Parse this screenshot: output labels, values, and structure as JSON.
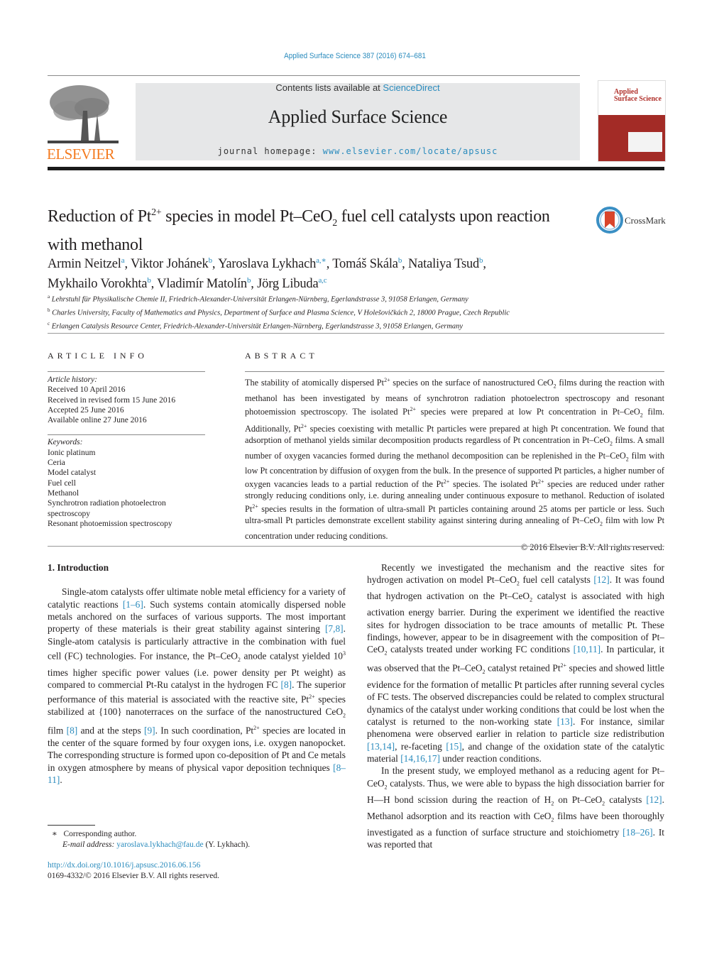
{
  "header": {
    "citation": "Applied Surface Science 387 (2016) 674–681",
    "contents_prefix": "Contents lists available at ",
    "contents_link": "ScienceDirect",
    "journal_name": "Applied Surface Science",
    "homepage_prefix": "journal homepage: ",
    "homepage_link": "www.elsevier.com/locate/apsusc",
    "publisher": "ELSEVIER",
    "cover_title_line1": "Applied",
    "cover_title_line2": "Surface Science",
    "crossmark_label": "CrossMark"
  },
  "article": {
    "title_parts": {
      "a": "Reduction of Pt",
      "a_sup": "2+",
      "b": " species in model Pt–CeO",
      "b_sub": "2",
      "c": " fuel cell catalysts upon reaction with methanol"
    },
    "authors": [
      {
        "name": "Armin Neitzel",
        "aff": "a"
      },
      {
        "name": "Viktor Johánek",
        "aff": "b"
      },
      {
        "name": "Yaroslava Lykhach",
        "aff": "a,∗"
      },
      {
        "name": "Tomáš Skála",
        "aff": "b"
      },
      {
        "name": "Nataliya Tsud",
        "aff": "b"
      },
      {
        "name": "Mykhailo Vorokhta",
        "aff": "b"
      },
      {
        "name": "Vladimír Matolín",
        "aff": "b"
      },
      {
        "name": "Jörg Libuda",
        "aff": "a,c"
      }
    ],
    "affiliations": [
      {
        "label": "a",
        "text": "Lehrstuhl für Physikalische Chemie II, Friedrich-Alexander-Universität Erlangen-Nürnberg, Egerlandstrasse 3, 91058 Erlangen, Germany"
      },
      {
        "label": "b",
        "text": "Charles University, Faculty of Mathematics and Physics, Department of Surface and Plasma Science, V Holešovičkách 2, 18000 Prague, Czech Republic"
      },
      {
        "label": "c",
        "text": "Erlangen Catalysis Resource Center, Friedrich-Alexander-Universität Erlangen-Nürnberg, Egerlandstrasse 3, 91058 Erlangen, Germany"
      }
    ]
  },
  "article_info": {
    "heading": "ARTICLE INFO",
    "history_label": "Article history:",
    "history": [
      "Received 10 April 2016",
      "Received in revised form 15 June 2016",
      "Accepted 25 June 2016",
      "Available online 27 June 2016"
    ],
    "keywords_label": "Keywords:",
    "keywords": [
      "Ionic platinum",
      "Ceria",
      "Model catalyst",
      "Fuel cell",
      "Methanol",
      "Synchrotron radiation photoelectron spectroscopy",
      "Resonant photoemission spectroscopy"
    ]
  },
  "abstract": {
    "heading": "ABSTRACT",
    "html": "The stability of atomically dispersed Pt<sup>2+</sup> species on the surface of nanostructured CeO<sub>2</sub> films during the reaction with methanol has been investigated by means of synchrotron radiation photoelectron spectroscopy and resonant photoemission spectroscopy. The isolated Pt<sup>2+</sup> species were prepared at low Pt concentration in Pt–CeO<sub>2</sub> film. Additionally, Pt<sup>2+</sup> species coexisting with metallic Pt particles were prepared at high Pt concentration. We found that adsorption of methanol yields similar decomposition products regardless of Pt concentration in Pt–CeO<sub>2</sub> films. A small number of oxygen vacancies formed during the methanol decomposition can be replenished in the Pt–CeO<sub>2</sub> film with low Pt concentration by diffusion of oxygen from the bulk. In the presence of supported Pt particles, a higher number of oxygen vacancies leads to a partial reduction of the Pt<sup>2+</sup> species. The isolated Pt<sup>2+</sup> species are reduced under rather strongly reducing conditions only, i.e. during annealing under continuous exposure to methanol. Reduction of isolated Pt<sup>2+</sup> species results in the formation of ultra-small Pt particles containing around 25 atoms per particle or less. Such ultra-small Pt particles demonstrate excellent stability against sintering during annealing of Pt–CeO<sub>2</sub> film with low Pt concentration under reducing conditions.",
    "copyright": "© 2016 Elsevier B.V. All rights reserved."
  },
  "body": {
    "section_heading": "1.  Introduction",
    "left_paragraphs_html": [
      "Single-atom catalysts offer ultimate noble metal efficiency for a variety of catalytic reactions <a>[1–6]</a>. Such systems contain atomically dispersed noble metals anchored on the surfaces of various supports. The most important property of these materials is their great stability against sintering <a>[7,8]</a>. Single-atom catalysis is particularly attractive in the combination with fuel cell (FC) technologies. For instance, the Pt–CeO<sub>2</sub> anode catalyst yielded 10<sup>3</sup> times higher specific power values (i.e. power density per Pt weight) as compared to commercial Pt-Ru catalyst in the hydrogen FC <a>[8]</a>. The superior performance of this material is associated with the reactive site, Pt<sup>2+</sup> species stabilized at {100} nanoterraces on the surface of the nanostructured CeO<sub>2</sub> film <a>[8]</a> and at the steps <a>[9]</a>. In such coordination, Pt<sup>2+</sup> species are located in the center of the square formed by four oxygen ions, i.e. oxygen nanopocket. The corresponding structure is formed upon co-deposition of Pt and Ce metals in oxygen atmosphere by means of physical vapor deposition techniques <a>[8–11]</a>."
    ],
    "right_paragraphs_html": [
      "Recently we investigated the mechanism and the reactive sites for hydrogen activation on model Pt–CeO<sub>2</sub> fuel cell catalysts <a>[12]</a>. It was found that hydrogen activation on the Pt–CeO<sub>2</sub> catalyst is associated with high activation energy barrier. During the experiment we identified the reactive sites for hydrogen dissociation to be trace amounts of metallic Pt. These findings, however, appear to be in disagreement with the composition of Pt–CeO<sub>2</sub> catalysts treated under working FC conditions <a>[10,11]</a>. In particular, it was observed that the Pt–CeO<sub>2</sub> catalyst retained Pt<sup>2+</sup> species and showed little evidence for the formation of metallic Pt particles after running several cycles of FC tests. The observed discrepancies could be related to complex structural dynamics of the catalyst under working conditions that could be lost when the catalyst is returned to the non-working state <a>[13]</a>. For instance, similar phenomena were observed earlier in relation to particle size redistribution <a>[13,14]</a>, re-faceting <a>[15]</a>, and change of the oxidation state of the catalytic material <a>[14,16,17]</a> under reaction conditions.",
      "In the present study, we employed methanol as a reducing agent for Pt–CeO<sub>2</sub> catalysts. Thus, we were able to bypass the high dissociation barrier for H—H bond scission during the reaction of H<sub>2</sub> on Pt–CeO<sub>2</sub> catalysts <a>[12]</a>. Methanol adsorption and its reaction with CeO<sub>2</sub> films have been thoroughly investigated as a function of surface structure and stoichiometry <a>[18–26]</a>. It was reported that"
    ]
  },
  "footnotes": {
    "corresponding_marker": "∗",
    "corresponding_text": "Corresponding author.",
    "email_label": "E-mail address: ",
    "email": "yaroslava.lykhach@fau.de",
    "email_suffix": " (Y. Lykhach).",
    "doi": "http://dx.doi.org/10.1016/j.apsusc.2016.06.156",
    "issn_line": "0169-4332/© 2016 Elsevier B.V. All rights reserved."
  }
}
